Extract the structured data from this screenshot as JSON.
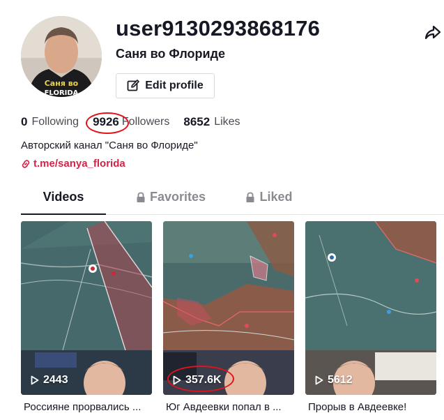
{
  "profile": {
    "username": "user9130293868176",
    "nickname": "Саня во Флориде",
    "edit_label": "Edit profile",
    "bio": "Авторский канал \"Саня во Флориде\"",
    "link": "t.me/sanya_florida",
    "avatar_shirt_text": "Саня во",
    "avatar_shirt_text2": "FLORIDA"
  },
  "stats": {
    "following_count": "0",
    "following_label": "Following",
    "followers_count": "9926",
    "followers_label": "Followers",
    "likes_count": "8652",
    "likes_label": "Likes"
  },
  "tabs": [
    {
      "label": "Videos",
      "active": true,
      "locked": false
    },
    {
      "label": "Favorites",
      "active": false,
      "locked": true
    },
    {
      "label": "Liked",
      "active": false,
      "locked": true
    }
  ],
  "videos": [
    {
      "views": "2443",
      "caption": "Россияне прорвались ..."
    },
    {
      "views": "357.6K",
      "caption": "Юг Авдеевки попал в ..."
    },
    {
      "views": "5612",
      "caption": "Прорыв в Авдеевке!"
    }
  ],
  "colors": {
    "accent": "#d32448",
    "annotation_circle": "#e0121c",
    "text_primary": "#161823",
    "text_secondary": "#8a8b91"
  }
}
